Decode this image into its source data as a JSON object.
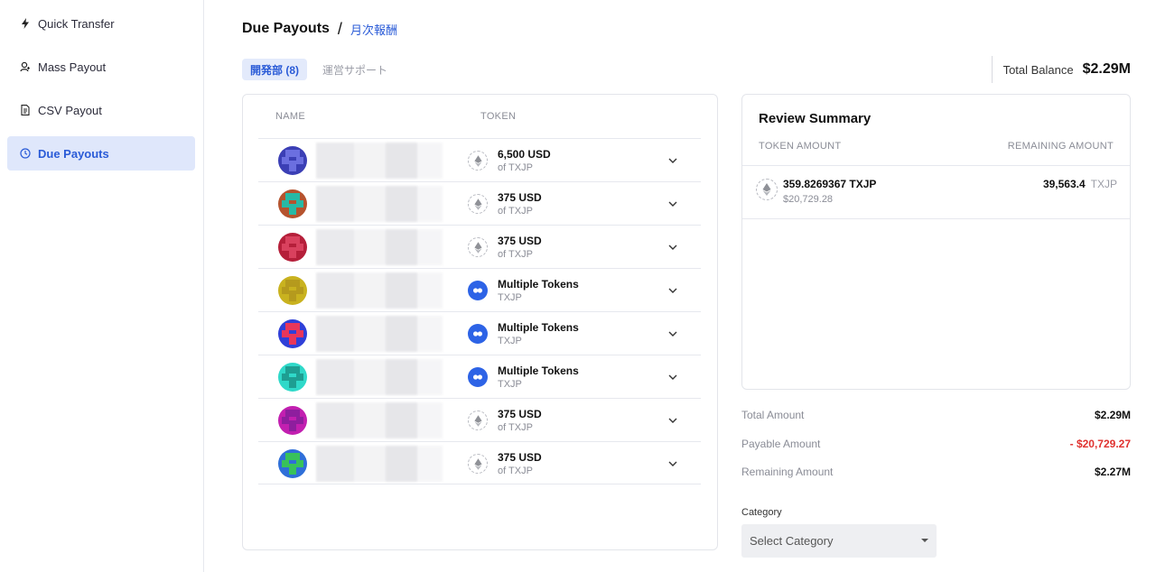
{
  "sidebar": {
    "items": [
      {
        "label": "Quick Transfer",
        "icon": "bolt-icon",
        "active": false
      },
      {
        "label": "Mass Payout",
        "icon": "user-icon",
        "active": false
      },
      {
        "label": "CSV Payout",
        "icon": "document-icon",
        "active": false
      },
      {
        "label": "Due Payouts",
        "icon": "clock-icon",
        "active": true
      }
    ]
  },
  "header": {
    "title": "Due Payouts",
    "separator": "/",
    "breadcrumb": "月次報酬"
  },
  "tabs": [
    {
      "label": "開発部 (8)",
      "active": true
    },
    {
      "label": "運営サポート",
      "active": false
    }
  ],
  "balance": {
    "label": "Total Balance",
    "value": "$2.29M"
  },
  "list": {
    "col_name": "NAME",
    "col_token": "TOKEN",
    "rows": [
      {
        "avatar_colors": [
          "#3b3fb5",
          "#6b6fe0"
        ],
        "token_type": "eth",
        "amount": "6,500 USD",
        "sub": "of TXJP"
      },
      {
        "avatar_colors": [
          "#b5532e",
          "#27b9a5"
        ],
        "token_type": "eth",
        "amount": "375 USD",
        "sub": "of TXJP"
      },
      {
        "avatar_colors": [
          "#b51f3a",
          "#d9415e"
        ],
        "token_type": "eth",
        "amount": "375 USD",
        "sub": "of TXJP"
      },
      {
        "avatar_colors": [
          "#c9b21f",
          "#b59a1d"
        ],
        "token_type": "multi",
        "amount": "Multiple Tokens",
        "sub": "TXJP"
      },
      {
        "avatar_colors": [
          "#2f3fd8",
          "#e8365a"
        ],
        "token_type": "multi",
        "amount": "Multiple Tokens",
        "sub": "TXJP"
      },
      {
        "avatar_colors": [
          "#2fd9c9",
          "#1e9e92"
        ],
        "token_type": "multi",
        "amount": "Multiple Tokens",
        "sub": "TXJP"
      },
      {
        "avatar_colors": [
          "#c21fb0",
          "#8e1e9e"
        ],
        "token_type": "eth",
        "amount": "375 USD",
        "sub": "of TXJP"
      },
      {
        "avatar_colors": [
          "#2f6fd8",
          "#38c25a"
        ],
        "token_type": "eth",
        "amount": "375 USD",
        "sub": "of TXJP"
      }
    ]
  },
  "review": {
    "title": "Review Summary",
    "col_token_amount": "TOKEN AMOUNT",
    "col_remaining": "REMAINING AMOUNT",
    "item": {
      "amount": "359.8269367 TXJP",
      "sub": "$20,729.28",
      "remaining": "39,563.4",
      "remaining_unit": "TXJP"
    }
  },
  "summary": {
    "total_label": "Total Amount",
    "total_value": "$2.29M",
    "payable_label": "Payable Amount",
    "payable_value": "- $20,729.27",
    "remaining_label": "Remaining Amount",
    "remaining_value": "$2.27M"
  },
  "category": {
    "label": "Category",
    "placeholder": "Select Category"
  },
  "colors": {
    "accent": "#2a5bd7",
    "negative": "#e0322f",
    "multi_token": "#2d63e6"
  }
}
